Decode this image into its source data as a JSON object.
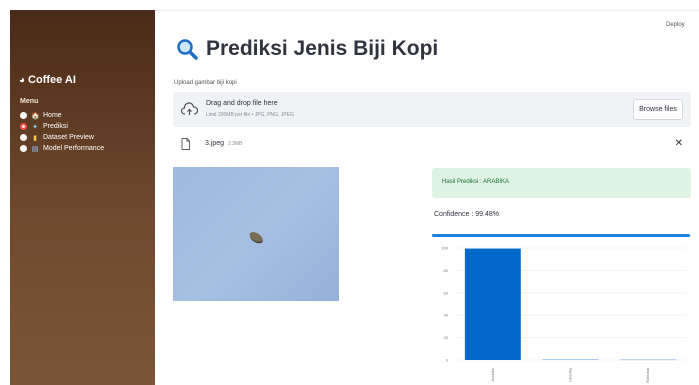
{
  "app": {
    "deploy_label": "Deploy"
  },
  "sidebar": {
    "brand": "Coffee AI",
    "menu_label": "Menu",
    "items": [
      {
        "label": "Home",
        "icon": "house-icon",
        "selected": false
      },
      {
        "label": "Prediksi",
        "icon": "sparkle-icon",
        "selected": true
      },
      {
        "label": "Dataset Preview",
        "icon": "folder-icon",
        "selected": false
      },
      {
        "label": "Model Performance",
        "icon": "bar-chart-icon",
        "selected": false
      }
    ],
    "colors": {
      "top": "#4a2a18",
      "bottom": "#7a5538",
      "selected_radio": "#ff4b4b"
    }
  },
  "main": {
    "title": "Prediksi Jenis Biji Kopi",
    "upload_label": "Upload gambar biji kopi",
    "dropzone": {
      "title": "Drag and drop file here",
      "subtitle": "Limit 200MB per file • JPG, PNG, JPEG",
      "browse_label": "Browse files"
    },
    "file": {
      "name": "3.jpeg",
      "size": "2.3MB"
    },
    "result": {
      "text": "Hasil Prediksi : ARABIKA",
      "confidence_text": "Confidence : 99.48%",
      "confidence": 0.9948
    }
  },
  "chart_data": {
    "type": "bar",
    "categories": [
      "Arabika",
      "Liberika",
      "Robusta"
    ],
    "values": [
      99.48,
      0.3,
      0.22
    ],
    "ylim": [
      0,
      100
    ],
    "yticks": [
      0,
      20,
      40,
      60,
      80,
      100
    ],
    "color": "#0068c9"
  }
}
